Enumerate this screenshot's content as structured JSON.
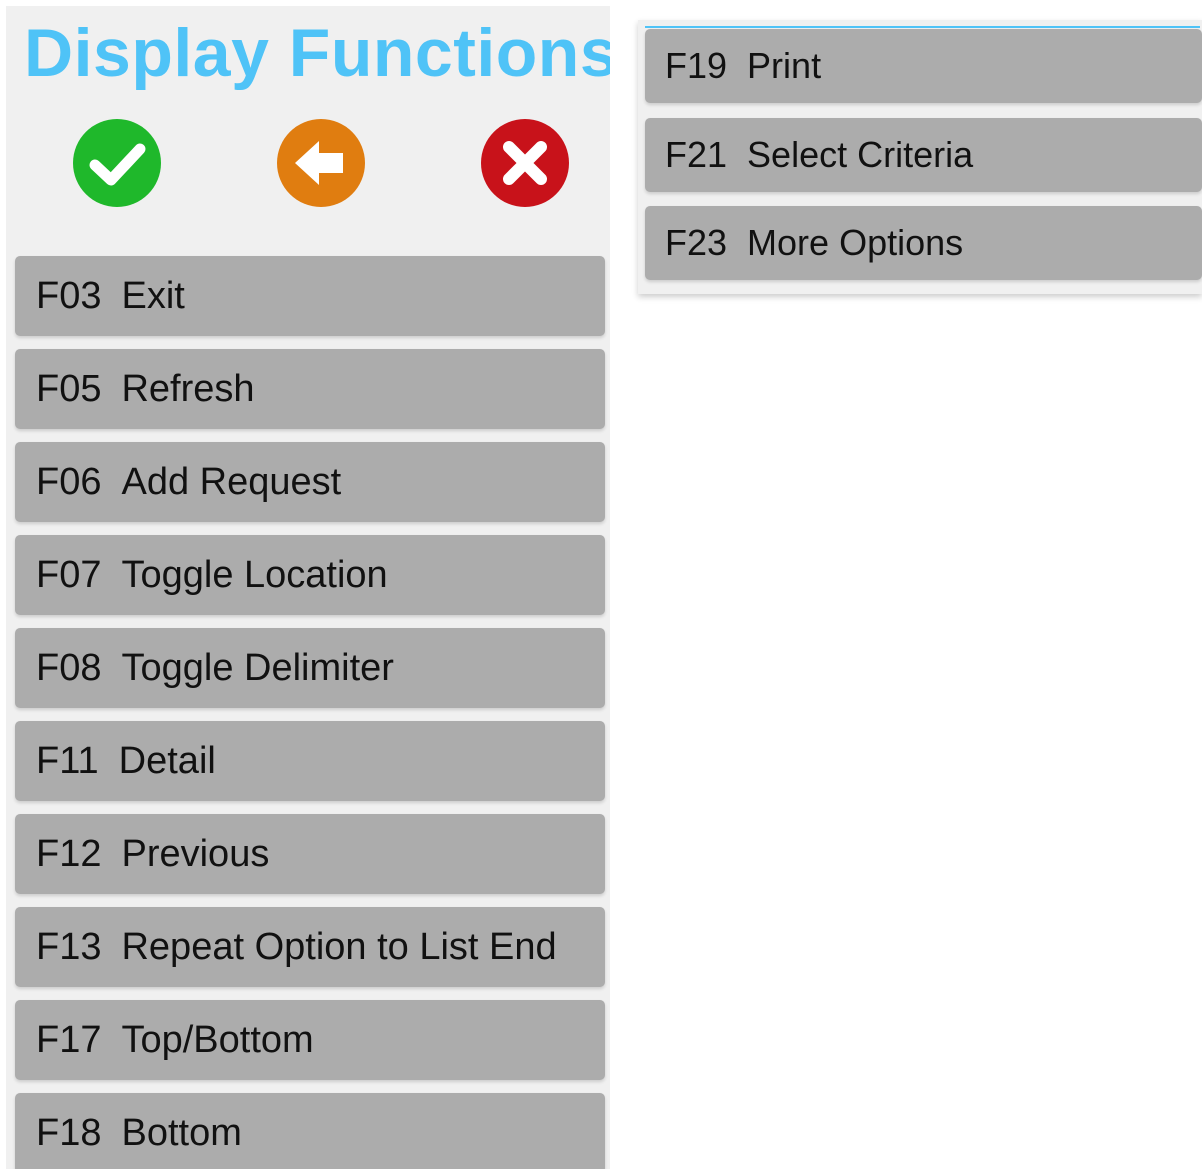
{
  "header": {
    "title": "Display Functions"
  },
  "actions": {
    "confirm_icon": "check-icon",
    "back_icon": "arrow-left-icon",
    "cancel_icon": "close-icon",
    "colors": {
      "confirm": "#1fb82b",
      "back": "#e07d10",
      "cancel": "#c8121a",
      "title": "#4fc3f7",
      "button": "#acacac"
    }
  },
  "functions": [
    {
      "key": "F03",
      "label": "Exit"
    },
    {
      "key": "F05",
      "label": "Refresh"
    },
    {
      "key": "F06",
      "label": "Add Request"
    },
    {
      "key": "F07",
      "label": "Toggle Location"
    },
    {
      "key": "F08",
      "label": "Toggle Delimiter"
    },
    {
      "key": "F11",
      "label": "Detail"
    },
    {
      "key": "F12",
      "label": "Previous"
    },
    {
      "key": "F13",
      "label": "Repeat Option to List End"
    },
    {
      "key": "F17",
      "label": "Top/Bottom"
    },
    {
      "key": "F18",
      "label": "Bottom"
    }
  ],
  "more_functions": [
    {
      "key": "F19",
      "label": "Print"
    },
    {
      "key": "F21",
      "label": "Select Criteria"
    },
    {
      "key": "F23",
      "label": "More Options"
    }
  ]
}
